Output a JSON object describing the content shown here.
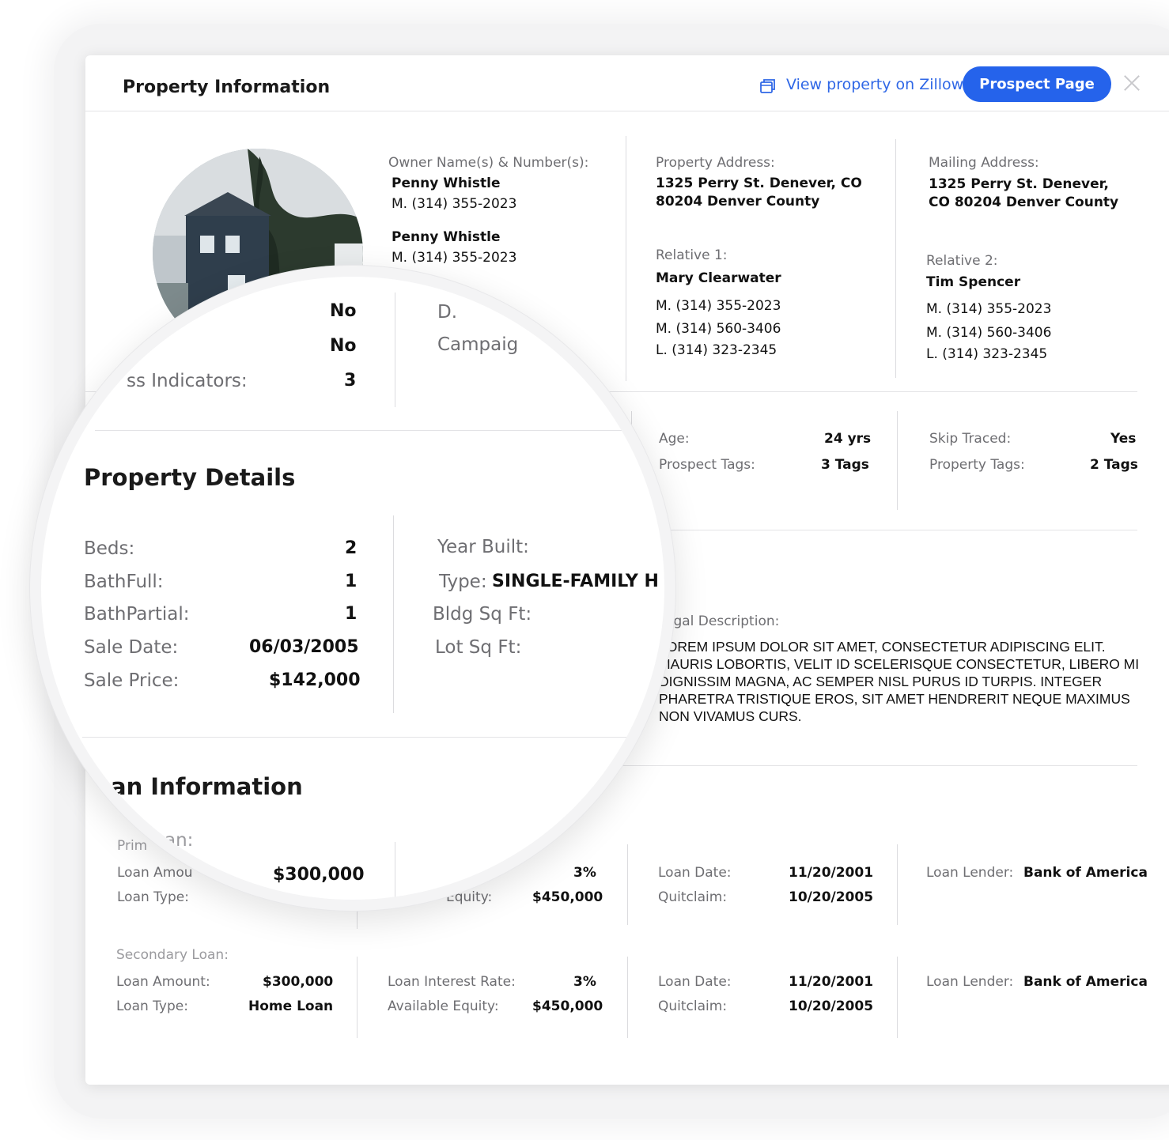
{
  "header": {
    "title": "Property Information",
    "zillow_link": "View property on Zillow",
    "prospect_button": "Prospect Page"
  },
  "owners": {
    "label": "Owner Name(s) & Number(s):",
    "list": [
      {
        "name": "Penny Whistle",
        "phone": "M. (314) 355-2023"
      },
      {
        "name": "Penny Whistle",
        "phone": "M. (314) 355-2023"
      }
    ]
  },
  "property_address": {
    "label": "Property Address:",
    "line1": "1325 Perry St. Denever, CO",
    "line2": "80204 Denver County"
  },
  "mailing_address": {
    "label": "Mailing Address:",
    "line1": "1325 Perry St. Denever,",
    "line2": "CO 80204 Denver County"
  },
  "relative1": {
    "label": "Relative 1:",
    "name": "Mary Clearwater",
    "phones": [
      "M. (314) 355-2023",
      "M. (314) 560-3406",
      "L. (314) 323-2345"
    ]
  },
  "relative2": {
    "label": "Relative 2:",
    "name": "Tim Spencer",
    "phones": [
      "M. (314) 355-2023",
      "M. (314) 560-3406",
      "L. (314) 323-2345"
    ]
  },
  "stats": {
    "age_label": "Age:",
    "age": "24 yrs",
    "prospect_tags_label": "Prospect Tags:",
    "prospect_tags": "3 Tags",
    "skip_traced_label": "Skip Traced:",
    "skip_traced": "Yes",
    "property_tags_label": "Property Tags:",
    "property_tags": "2 Tags"
  },
  "magnified": {
    "row1_value": "No",
    "row2_value": "No",
    "indicators_label": "ss Indicators:",
    "indicators_value": "3",
    "d_label": "D.",
    "campaign_label": "Campaig",
    "section_title": "Property Details",
    "beds_label": "Beds:",
    "beds": "2",
    "bathfull_label": "BathFull:",
    "bathfull": "1",
    "bathpartial_label": "BathPartial:",
    "bathpartial": "1",
    "sale_date_label": "Sale Date:",
    "sale_date": "06/03/2005",
    "sale_price_label": "Sale Price:",
    "sale_price": "$142,000",
    "year_built_label": "Year Built:",
    "type_label": "Type:",
    "type": "SINGLE-FAMILY H",
    "bldg_label": "Bldg Sq Ft:",
    "lot_label": "Lot Sq Ft:",
    "loan_title": "an Information",
    "primary_label": "an:",
    "primary_amount": "$300,000"
  },
  "legal": {
    "label": "egal Description:",
    "text": "LOREM IPSUM DOLOR SIT AMET, CONSECTETUR ADIPISCING ELIT. MAURIS LOBORTIS, VELIT ID SCELERISQUE CONSECTETUR, LIBERO MI DIGNISSIM MAGNA, AC SEMPER NISL PURUS ID TURPIS. INTEGER PHARETRA TRISTIQUE EROS, SIT AMET HENDRERIT NEQUE MAXIMUS NON VIVAMUS CURS."
  },
  "primary_loan": {
    "label_fragment": "Prim",
    "amount_label_fragment": "Loan Amou",
    "type_label": "Loan Type:",
    "rate_label_fragment": "L",
    "rate_label_fragment2": "e:",
    "rate": "3%",
    "equity_label_fragment": "Equity:",
    "equity": "$450,000",
    "date_label": "Loan Date:",
    "date": "11/20/2001",
    "quitclaim_label": "Quitclaim:",
    "quitclaim": "10/20/2005",
    "lender_label": "Loan Lender:",
    "lender": "Bank of America"
  },
  "secondary_loan": {
    "label": "Secondary Loan:",
    "amount_label": "Loan Amount:",
    "amount": "$300,000",
    "type_label": "Loan Type:",
    "type": "Home Loan",
    "rate_label": "Loan Interest Rate:",
    "rate": "3%",
    "equity_label": "Available Equity:",
    "equity": "$450,000",
    "date_label": "Loan Date:",
    "date": "11/20/2001",
    "quitclaim_label": "Quitclaim:",
    "quitclaim": "10/20/2005",
    "lender_label": "Loan Lender:",
    "lender": "Bank of America"
  },
  "colors": {
    "accent": "#2563eb",
    "link": "#2f67e6"
  },
  "icons": {
    "zillow": "external-window-icon",
    "close": "close-icon"
  }
}
